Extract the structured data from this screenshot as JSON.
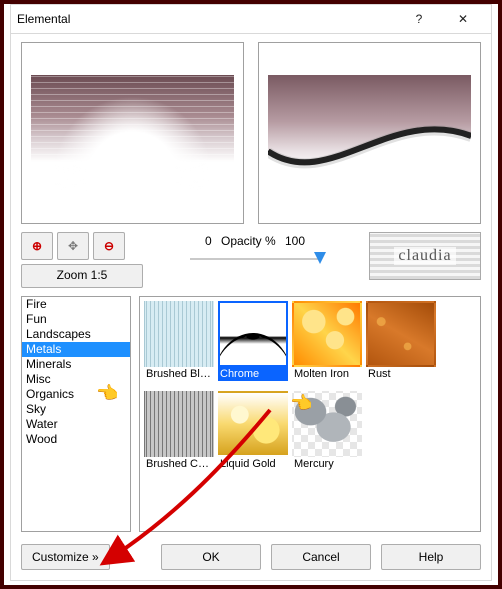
{
  "window": {
    "title": "Elemental"
  },
  "zoom": {
    "label": "Zoom 1:5"
  },
  "opacity": {
    "min": "0",
    "label": "Opacity %",
    "max": "100",
    "value_pct": 100
  },
  "brand": {
    "label": "claudia"
  },
  "categories": [
    {
      "label": "Fire"
    },
    {
      "label": "Fun"
    },
    {
      "label": "Landscapes"
    },
    {
      "label": "Metals",
      "selected": true
    },
    {
      "label": "Minerals"
    },
    {
      "label": "Misc"
    },
    {
      "label": "Organics"
    },
    {
      "label": "Sky"
    },
    {
      "label": "Water"
    },
    {
      "label": "Wood"
    }
  ],
  "thumbs": [
    {
      "label": "Brushed Blu...",
      "cls": "p-brushblue"
    },
    {
      "label": "Chrome",
      "cls": "p-chrome",
      "selected": true
    },
    {
      "label": "Molten Iron",
      "cls": "p-molten"
    },
    {
      "label": "Rust",
      "cls": "p-rust"
    },
    {
      "label": "Brushed Col...",
      "cls": "p-brushcol"
    },
    {
      "label": "Liquid Gold",
      "cls": "p-gold"
    },
    {
      "label": "Mercury",
      "cls": "p-mercury"
    }
  ],
  "buttons": {
    "customize": "Customize   »",
    "ok": "OK",
    "cancel": "Cancel",
    "help": "Help"
  },
  "icons": {
    "help": "?",
    "close": "✕",
    "zoomin": "⊕",
    "pan": "✥",
    "zoomout": "⊖"
  }
}
